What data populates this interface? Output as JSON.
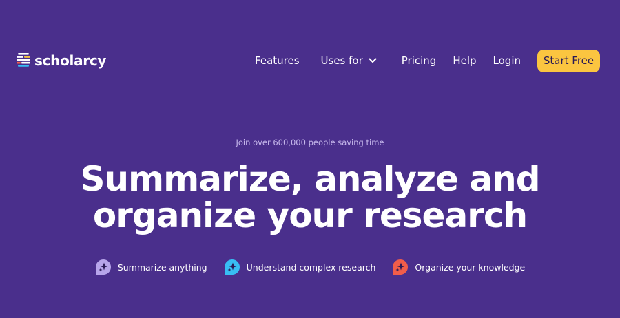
{
  "header": {
    "logo_text": "scholarcy",
    "nav": {
      "features": "Features",
      "uses_for": "Uses for",
      "pricing": "Pricing",
      "help": "Help",
      "login": "Login"
    },
    "cta_label": "Start Free"
  },
  "hero": {
    "eyebrow": "Join over 600,000 people saving time",
    "headline_line1": "Summarize, analyze and",
    "headline_line2": "organize your research",
    "features": [
      {
        "label": "Summarize anything",
        "icon": "sparkle-chat-icon",
        "color": "#b7a5ea"
      },
      {
        "label": "Understand complex research",
        "icon": "sparkle-chat-icon",
        "color": "#38bdf3"
      },
      {
        "label": "Organize your knowledge",
        "icon": "sparkle-chat-icon",
        "color": "#f15d4a"
      }
    ]
  },
  "colors": {
    "background": "#4a2f8c",
    "cta_background": "#fbc540",
    "cta_text": "#2a1a55",
    "eyebrow_text": "#c6b8ec"
  }
}
